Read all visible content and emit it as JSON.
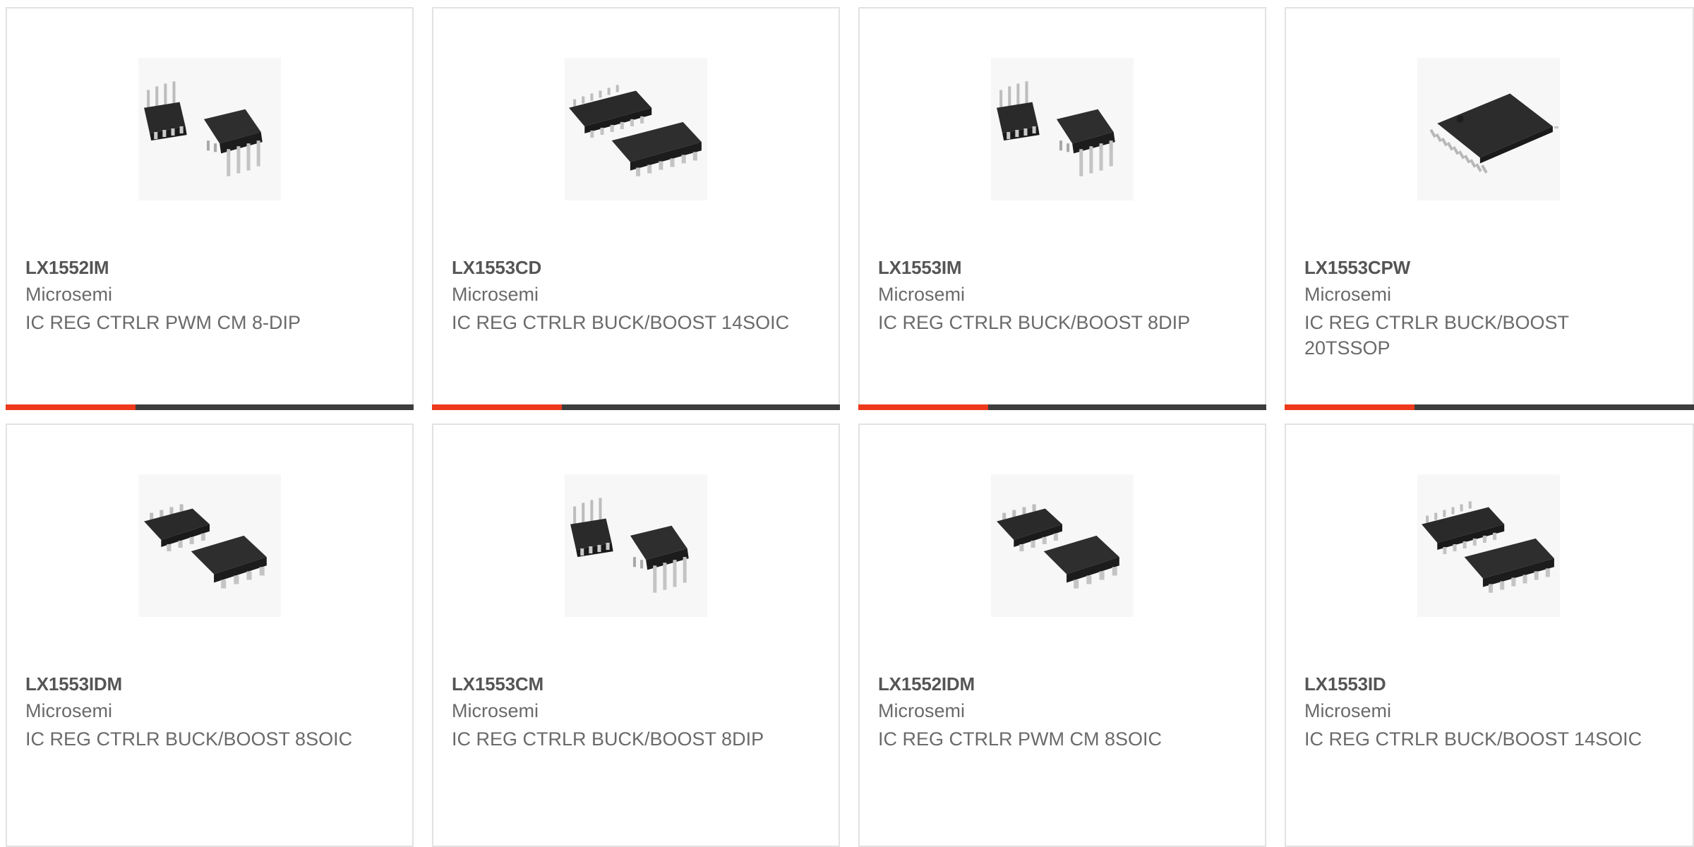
{
  "colors": {
    "accent": "#ee3a1c",
    "bar": "#3d3d3d",
    "border": "#e2e2e2",
    "text": "#6a6a6a"
  },
  "products": [
    {
      "part": "LX1552IM",
      "maker": "Microsemi",
      "desc": "IC REG CTRLR PWM CM 8-DIP",
      "image": "dip8-package-icon"
    },
    {
      "part": "LX1553CD",
      "maker": "Microsemi",
      "desc": "IC REG CTRLR BUCK/BOOST 14SOIC",
      "image": "soic14-package-icon"
    },
    {
      "part": "LX1553IM",
      "maker": "Microsemi",
      "desc": "IC REG CTRLR BUCK/BOOST 8DIP",
      "image": "dip8-package-icon"
    },
    {
      "part": "LX1553CPW",
      "maker": "Microsemi",
      "desc": "IC REG CTRLR BUCK/BOOST 20TSSOP",
      "image": "tssop20-package-icon"
    },
    {
      "part": "LX1553IDM",
      "maker": "Microsemi",
      "desc": "IC REG CTRLR BUCK/BOOST 8SOIC",
      "image": "soic8-package-icon"
    },
    {
      "part": "LX1553CM",
      "maker": "Microsemi",
      "desc": "IC REG CTRLR BUCK/BOOST 8DIP",
      "image": "dip8-package-icon"
    },
    {
      "part": "LX1552IDM",
      "maker": "Microsemi",
      "desc": "IC REG CTRLR PWM CM 8SOIC",
      "image": "soic8-package-icon"
    },
    {
      "part": "LX1553ID",
      "maker": "Microsemi",
      "desc": "IC REG CTRLR BUCK/BOOST 14SOIC",
      "image": "soic14-package-icon"
    }
  ]
}
